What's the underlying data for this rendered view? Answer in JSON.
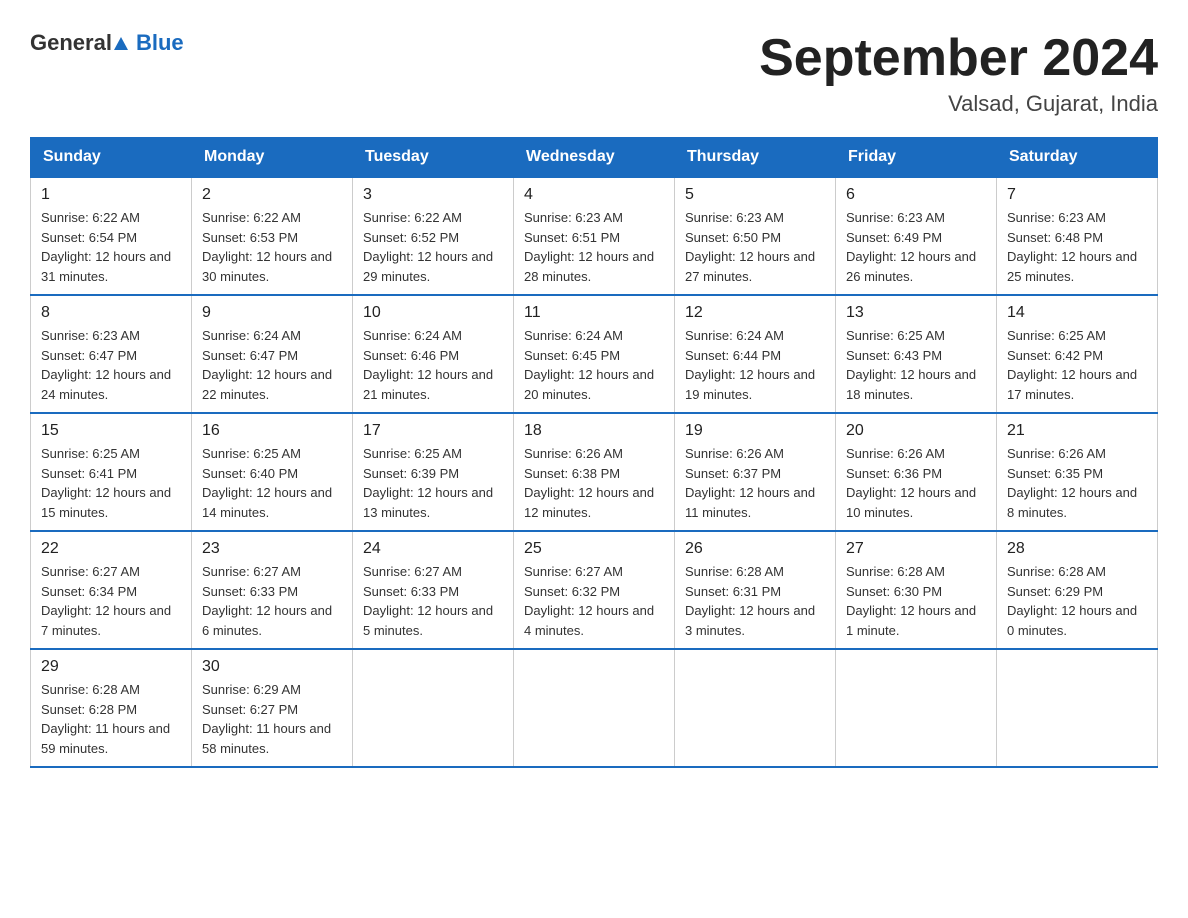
{
  "logo": {
    "text_general": "General",
    "text_blue": "Blue"
  },
  "header": {
    "month_year": "September 2024",
    "location": "Valsad, Gujarat, India"
  },
  "weekdays": [
    "Sunday",
    "Monday",
    "Tuesday",
    "Wednesday",
    "Thursday",
    "Friday",
    "Saturday"
  ],
  "weeks": [
    [
      {
        "day": "1",
        "sunrise": "Sunrise: 6:22 AM",
        "sunset": "Sunset: 6:54 PM",
        "daylight": "Daylight: 12 hours and 31 minutes."
      },
      {
        "day": "2",
        "sunrise": "Sunrise: 6:22 AM",
        "sunset": "Sunset: 6:53 PM",
        "daylight": "Daylight: 12 hours and 30 minutes."
      },
      {
        "day": "3",
        "sunrise": "Sunrise: 6:22 AM",
        "sunset": "Sunset: 6:52 PM",
        "daylight": "Daylight: 12 hours and 29 minutes."
      },
      {
        "day": "4",
        "sunrise": "Sunrise: 6:23 AM",
        "sunset": "Sunset: 6:51 PM",
        "daylight": "Daylight: 12 hours and 28 minutes."
      },
      {
        "day": "5",
        "sunrise": "Sunrise: 6:23 AM",
        "sunset": "Sunset: 6:50 PM",
        "daylight": "Daylight: 12 hours and 27 minutes."
      },
      {
        "day": "6",
        "sunrise": "Sunrise: 6:23 AM",
        "sunset": "Sunset: 6:49 PM",
        "daylight": "Daylight: 12 hours and 26 minutes."
      },
      {
        "day": "7",
        "sunrise": "Sunrise: 6:23 AM",
        "sunset": "Sunset: 6:48 PM",
        "daylight": "Daylight: 12 hours and 25 minutes."
      }
    ],
    [
      {
        "day": "8",
        "sunrise": "Sunrise: 6:23 AM",
        "sunset": "Sunset: 6:47 PM",
        "daylight": "Daylight: 12 hours and 24 minutes."
      },
      {
        "day": "9",
        "sunrise": "Sunrise: 6:24 AM",
        "sunset": "Sunset: 6:47 PM",
        "daylight": "Daylight: 12 hours and 22 minutes."
      },
      {
        "day": "10",
        "sunrise": "Sunrise: 6:24 AM",
        "sunset": "Sunset: 6:46 PM",
        "daylight": "Daylight: 12 hours and 21 minutes."
      },
      {
        "day": "11",
        "sunrise": "Sunrise: 6:24 AM",
        "sunset": "Sunset: 6:45 PM",
        "daylight": "Daylight: 12 hours and 20 minutes."
      },
      {
        "day": "12",
        "sunrise": "Sunrise: 6:24 AM",
        "sunset": "Sunset: 6:44 PM",
        "daylight": "Daylight: 12 hours and 19 minutes."
      },
      {
        "day": "13",
        "sunrise": "Sunrise: 6:25 AM",
        "sunset": "Sunset: 6:43 PM",
        "daylight": "Daylight: 12 hours and 18 minutes."
      },
      {
        "day": "14",
        "sunrise": "Sunrise: 6:25 AM",
        "sunset": "Sunset: 6:42 PM",
        "daylight": "Daylight: 12 hours and 17 minutes."
      }
    ],
    [
      {
        "day": "15",
        "sunrise": "Sunrise: 6:25 AM",
        "sunset": "Sunset: 6:41 PM",
        "daylight": "Daylight: 12 hours and 15 minutes."
      },
      {
        "day": "16",
        "sunrise": "Sunrise: 6:25 AM",
        "sunset": "Sunset: 6:40 PM",
        "daylight": "Daylight: 12 hours and 14 minutes."
      },
      {
        "day": "17",
        "sunrise": "Sunrise: 6:25 AM",
        "sunset": "Sunset: 6:39 PM",
        "daylight": "Daylight: 12 hours and 13 minutes."
      },
      {
        "day": "18",
        "sunrise": "Sunrise: 6:26 AM",
        "sunset": "Sunset: 6:38 PM",
        "daylight": "Daylight: 12 hours and 12 minutes."
      },
      {
        "day": "19",
        "sunrise": "Sunrise: 6:26 AM",
        "sunset": "Sunset: 6:37 PM",
        "daylight": "Daylight: 12 hours and 11 minutes."
      },
      {
        "day": "20",
        "sunrise": "Sunrise: 6:26 AM",
        "sunset": "Sunset: 6:36 PM",
        "daylight": "Daylight: 12 hours and 10 minutes."
      },
      {
        "day": "21",
        "sunrise": "Sunrise: 6:26 AM",
        "sunset": "Sunset: 6:35 PM",
        "daylight": "Daylight: 12 hours and 8 minutes."
      }
    ],
    [
      {
        "day": "22",
        "sunrise": "Sunrise: 6:27 AM",
        "sunset": "Sunset: 6:34 PM",
        "daylight": "Daylight: 12 hours and 7 minutes."
      },
      {
        "day": "23",
        "sunrise": "Sunrise: 6:27 AM",
        "sunset": "Sunset: 6:33 PM",
        "daylight": "Daylight: 12 hours and 6 minutes."
      },
      {
        "day": "24",
        "sunrise": "Sunrise: 6:27 AM",
        "sunset": "Sunset: 6:33 PM",
        "daylight": "Daylight: 12 hours and 5 minutes."
      },
      {
        "day": "25",
        "sunrise": "Sunrise: 6:27 AM",
        "sunset": "Sunset: 6:32 PM",
        "daylight": "Daylight: 12 hours and 4 minutes."
      },
      {
        "day": "26",
        "sunrise": "Sunrise: 6:28 AM",
        "sunset": "Sunset: 6:31 PM",
        "daylight": "Daylight: 12 hours and 3 minutes."
      },
      {
        "day": "27",
        "sunrise": "Sunrise: 6:28 AM",
        "sunset": "Sunset: 6:30 PM",
        "daylight": "Daylight: 12 hours and 1 minute."
      },
      {
        "day": "28",
        "sunrise": "Sunrise: 6:28 AM",
        "sunset": "Sunset: 6:29 PM",
        "daylight": "Daylight: 12 hours and 0 minutes."
      }
    ],
    [
      {
        "day": "29",
        "sunrise": "Sunrise: 6:28 AM",
        "sunset": "Sunset: 6:28 PM",
        "daylight": "Daylight: 11 hours and 59 minutes."
      },
      {
        "day": "30",
        "sunrise": "Sunrise: 6:29 AM",
        "sunset": "Sunset: 6:27 PM",
        "daylight": "Daylight: 11 hours and 58 minutes."
      },
      null,
      null,
      null,
      null,
      null
    ]
  ]
}
